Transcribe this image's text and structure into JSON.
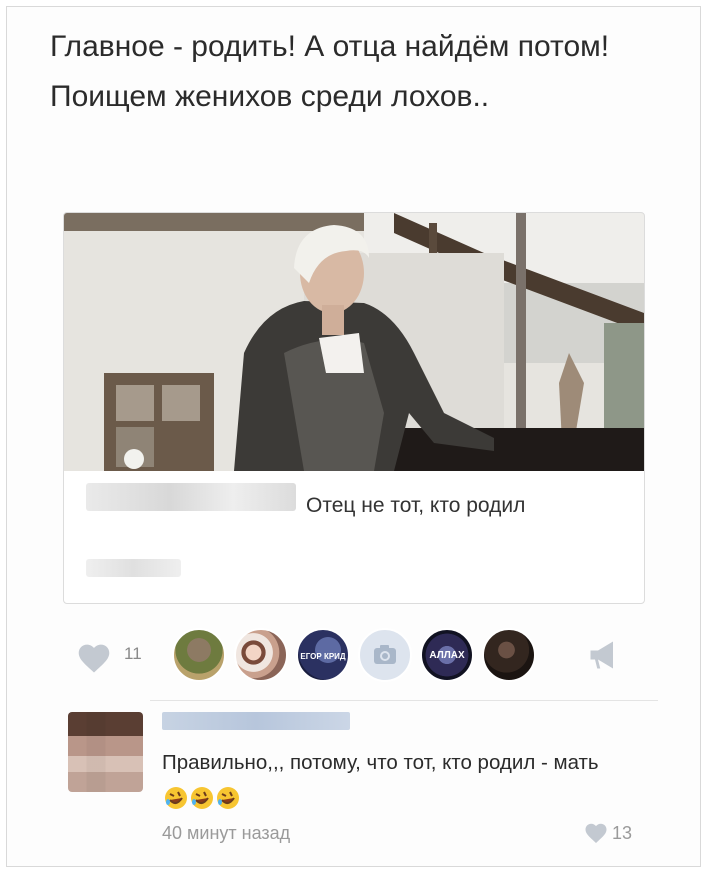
{
  "post": {
    "text": "Главное - родить! А отца найдём потом! Поищем женихов среди лохов.."
  },
  "repost": {
    "text": "Отец не тот, кто родил"
  },
  "actions": {
    "like_count": "11",
    "liker_avatars": [
      {
        "name": "avatar-1",
        "label": ""
      },
      {
        "name": "avatar-2",
        "label": ""
      },
      {
        "name": "avatar-3",
        "label": "ЕГОР КРИД"
      },
      {
        "name": "avatar-4",
        "label": ""
      },
      {
        "name": "avatar-5",
        "label": "АЛЛАХ"
      },
      {
        "name": "avatar-6",
        "label": ""
      }
    ]
  },
  "comment": {
    "text": "Правильно,,, потому, что тот, кто родил - мать",
    "time": "40 минут назад",
    "like_count": "13"
  },
  "colors": {
    "icon_gray": "#c3c9d1",
    "text_gray": "#9a9a9a"
  }
}
